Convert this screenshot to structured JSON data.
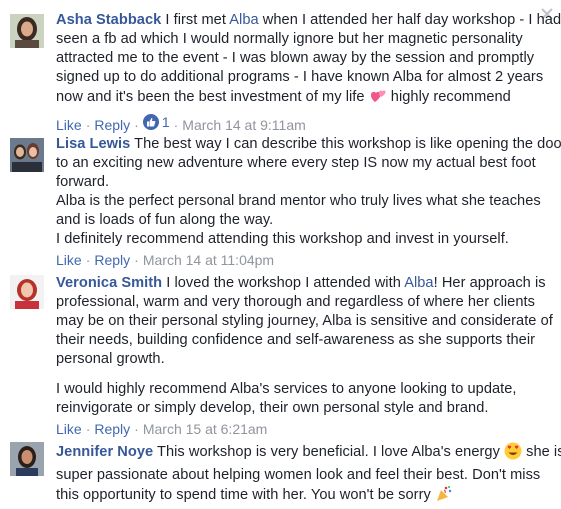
{
  "close_label": "×",
  "comments": [
    {
      "author": "Asha Stabback",
      "lines": [
        {
          "pre": " I first met ",
          "mention": "Alba",
          "post": " when I attended her half day workshop - I had"
        },
        "seen a fb ad which I would normally ignore but her magnetic personality",
        "attracted me to the event - I was blown away by the session and promptly",
        "signed up to do additional programs - I have known Alba for almost 2 years",
        {
          "pre": "now and it's been the best investment of my life ",
          "post": " highly recommend"
        }
      ],
      "actions": {
        "like": "Like",
        "reply": "Reply",
        "reaction_count": "1",
        "time": "March 14 at 9:11am"
      }
    },
    {
      "author": "Lisa Lewis",
      "lines": [
        " The best way I can describe this workshop is like opening the door",
        "to an exciting new adventure where every step IS now my actual best foot",
        "forward.",
        "Alba is the perfect personal brand mentor who truly lives what she teaches",
        "and is loads of fun along the way.",
        "I definitely recommend attending this workshop and invest in yourself."
      ],
      "actions": {
        "like": "Like",
        "reply": "Reply",
        "time": "March 14 at 11:04pm"
      }
    },
    {
      "author": "Veronica Smith",
      "lines": [
        {
          "pre": " I loved the workshop I attended with ",
          "mention": "Alba",
          "post": "! Her approach is"
        },
        "professional, warm and very thorough and regardless of where her clients",
        "may be on their personal styling journey, Alba is sensitive and considerate of",
        "their needs, building confidence and self-awareness as she supports their",
        "personal growth.",
        "I would highly recommend Alba's services to anyone looking to update,",
        "reinvigorate or simply develop, their own personal style and brand."
      ],
      "actions": {
        "like": "Like",
        "reply": "Reply",
        "time": "March 15 at 6:21am"
      }
    },
    {
      "author": "Jennifer Noye",
      "lines": [
        {
          "pre": " This workshop is very beneficial. I love Alba's energy ",
          "post": " she is"
        },
        "super passionate about helping women look and feel their best. Don't miss",
        "this opportunity to spend time with her. You won't be sorry "
      ]
    }
  ]
}
